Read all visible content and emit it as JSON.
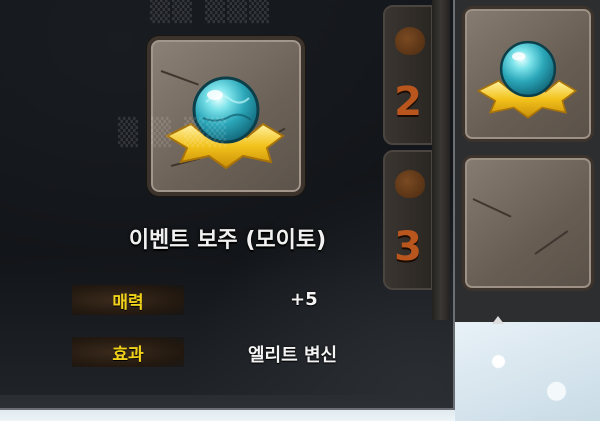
{
  "item": {
    "name": "이벤트 보주 (모이토)",
    "icon": "orb-on-golden-cloth-icon"
  },
  "stats": [
    {
      "label": "매력",
      "value": "+5"
    },
    {
      "label": "효과",
      "value": "엘리트 변신"
    }
  ],
  "tabs": [
    {
      "number": "2",
      "icon": "pouch-icon"
    },
    {
      "number": "3",
      "icon": "pouch-icon"
    }
  ],
  "inventory": {
    "slots": [
      {
        "icon": "orb-on-golden-cloth-icon",
        "filled": true
      },
      {
        "icon": "",
        "filled": false
      }
    ]
  },
  "colors": {
    "stat_label": "#f0d21a",
    "tab_number": "#b8561e",
    "orb": "#3ec6d4",
    "cloth": "#f2c21b"
  }
}
